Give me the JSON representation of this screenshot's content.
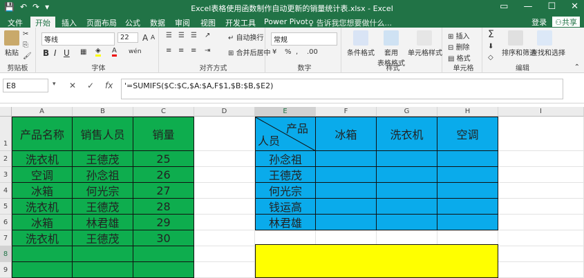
{
  "app": {
    "title": "Excel表格使用函数制作自动更新的销量统计表.xlsx - Excel",
    "window_controls": [
      "▭",
      "—",
      "☐",
      "✕"
    ],
    "quick_access": [
      "💾",
      "↶",
      "↷",
      "▾"
    ]
  },
  "tabs": [
    "文件",
    "开始",
    "插入",
    "页面布局",
    "公式",
    "数据",
    "审阅",
    "视图",
    "开发工具",
    "Power Pivot"
  ],
  "active_tab": "开始",
  "tell_me": "告诉我您想要做什么...",
  "account": {
    "login": "登录",
    "share": "共享"
  },
  "ribbon": {
    "clipboard": {
      "paste": "粘贴",
      "label": "剪贴板"
    },
    "font": {
      "name": "等线",
      "size": "22",
      "bold": "B",
      "italic": "I",
      "underline": "U",
      "grow": "A",
      "shrink": "A",
      "wen": "wén",
      "label": "字体"
    },
    "align": {
      "wrap": "自动换行",
      "merge": "合并后居中",
      "label": "对齐方式"
    },
    "number": {
      "format": "常规",
      "label": "数字",
      "percent": "%",
      "comma": ",",
      "incdec": ".00"
    },
    "styles": {
      "conditional": "条件格式",
      "table_1": "套用",
      "table_2": "表格格式",
      "cell_styles": "单元格样式",
      "label": "样式"
    },
    "cells": {
      "insert": "插入",
      "delete": "删除",
      "format": "格式",
      "label": "单元格"
    },
    "edit": {
      "sum": "Σ",
      "sort": "排序和筛选",
      "find": "查找和选择",
      "label": "编辑"
    }
  },
  "formula": {
    "namebox": "E8",
    "cancel": "✕",
    "enter": "✓",
    "fx": "fx",
    "text": "'=SUMIFS($C:$C,$A:$A,F$1,$B:$B,$E2)"
  },
  "columns": [
    "A",
    "B",
    "C",
    "D",
    "E",
    "F",
    "G",
    "H",
    "I"
  ],
  "rows": [
    "1",
    "2",
    "3",
    "4",
    "5",
    "6",
    "7",
    "8",
    "9"
  ],
  "left_table": {
    "headers": [
      "产品名称",
      "销售人员",
      "销量"
    ],
    "rows": [
      [
        "洗衣机",
        "王德茂",
        "25"
      ],
      [
        "空调",
        "孙念祖",
        "26"
      ],
      [
        "冰箱",
        "何光宗",
        "27"
      ],
      [
        "洗衣机",
        "王德茂",
        "28"
      ],
      [
        "冰箱",
        "林君雄",
        "29"
      ],
      [
        "洗衣机",
        "王德茂",
        "30"
      ]
    ]
  },
  "right_table": {
    "corner_top": "产品",
    "corner_bottom": "人员",
    "headers": [
      "冰箱",
      "洗衣机",
      "空调"
    ],
    "names": [
      "孙念祖",
      "王德茂",
      "何光宗",
      "钱运高",
      "林君雄"
    ]
  },
  "colors": {
    "excel_green": "#217346",
    "green_fill": "#0ead4e",
    "blue_fill": "#0aabeb",
    "yellow_fill": "#ffff00"
  }
}
